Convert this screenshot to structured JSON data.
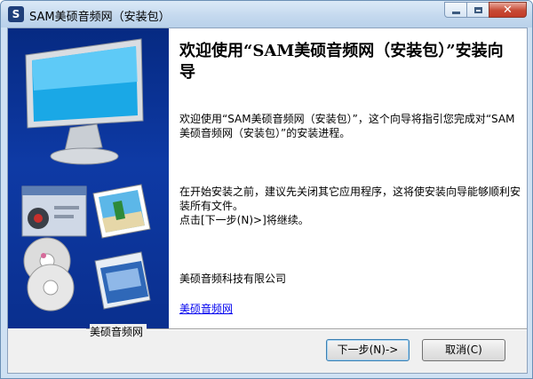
{
  "window": {
    "title": "SAM美硕音频网（安装包）",
    "icon": "app-logo-icon"
  },
  "main": {
    "heading": "欢迎使用“SAM美硕音频网（安装包）”安装向导",
    "paragraph1": "欢迎使用“SAM美硕音频网（安装包）”，这个向导将指引您完成对“SAM美硕音频网（安装包）”的安装进程。",
    "paragraph2": "在开始安装之前，建议先关闭其它应用程序，这将使安装向导能够顺利安装所有文件。",
    "paragraph3": "点击[下一步(N)>]将继续。",
    "company": "美硕音频科技有限公司",
    "link": "美硕音频网"
  },
  "footer": {
    "brand": "美硕音频网",
    "next_label": "下一步(N)->",
    "cancel_label": "取消(C)"
  },
  "colors": {
    "side_panel": "#0a2f8e",
    "link": "#0000ee",
    "close_button": "#c74a35"
  }
}
